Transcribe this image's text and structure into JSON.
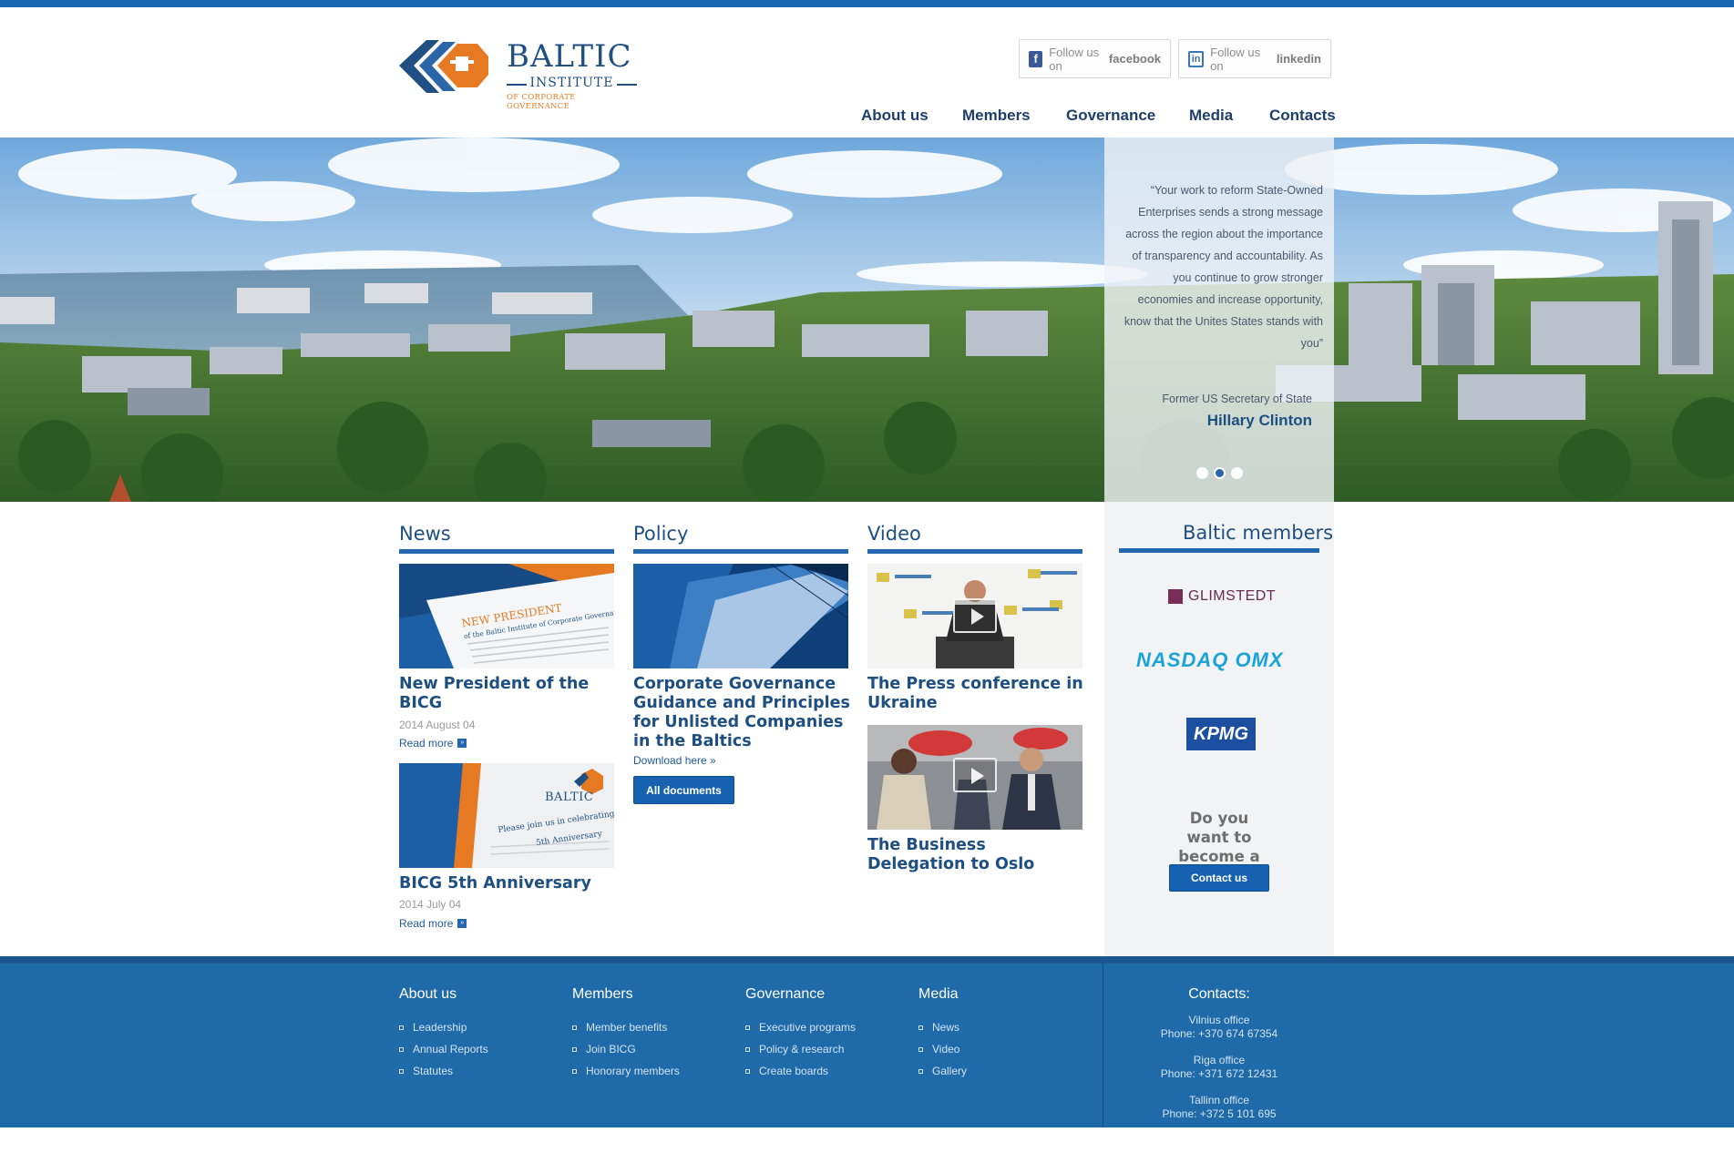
{
  "brand": {
    "title": "BALTIC",
    "subtitle": "INSTITUTE",
    "tagline": "OF CORPORATE GOVERNANCE"
  },
  "social": {
    "facebook": {
      "prefix": "Follow us on",
      "network": "facebook",
      "icon": "facebook-icon"
    },
    "linkedin": {
      "prefix": "Follow us on",
      "network": "linkedin",
      "icon": "linkedin-icon"
    }
  },
  "nav": [
    "About us",
    "Members",
    "Governance",
    "Media",
    "Contacts"
  ],
  "hero": {
    "quote": "“Your work to reform State-Owned Enterprises sends a strong message across the region about the importance of transparency and accountability. As you continue to grow stronger economies and increase opportunity, know that the Unites States stands with you”",
    "role": "Former US Secretary of State",
    "name": "Hillary Clinton",
    "slides": 3,
    "active_slide": 2
  },
  "news": {
    "title": "News",
    "items": [
      {
        "title": "New President of the BICG",
        "date": "2014 August 04",
        "more": "Read more",
        "thumb_text": "NEW PRESIDENT",
        "thumb_sub": "of the Baltic Institute of Corporate Governance Appointed"
      },
      {
        "title": "BICG 5th Anniversary",
        "date": "2014 July 04",
        "more": "Read more",
        "thumb_text": "Please join us in celebrating",
        "thumb_sub": "5th Anniversary"
      }
    ]
  },
  "policy": {
    "title": "Policy",
    "item_title": "Corporate Governance Guidance and Principles for Unlisted Companies in the Baltics",
    "download": "Download here »",
    "button": "All documents"
  },
  "video": {
    "title": "Video",
    "items": [
      {
        "title": "The Press conference in Ukraine"
      },
      {
        "title": "The Business Delegation to Oslo"
      }
    ]
  },
  "members": {
    "title": "Baltic members",
    "logos": [
      "GLIMSTEDT",
      "NASDAQ OMX",
      "KPMG"
    ],
    "cta": "Do you want to become a member?",
    "button": "Contact us"
  },
  "footer": {
    "columns": [
      {
        "title": "About us",
        "links": [
          "Leadership",
          "Annual Reports",
          "Statutes"
        ]
      },
      {
        "title": "Members",
        "links": [
          "Member benefits",
          "Join BICG",
          "Honorary members"
        ]
      },
      {
        "title": "Governance",
        "links": [
          "Executive programs",
          "Policy & research",
          "Create boards"
        ]
      },
      {
        "title": "Media",
        "links": [
          "News",
          "Video",
          "Gallery"
        ]
      }
    ],
    "contacts_title": "Contacts:",
    "offices": [
      {
        "name": "Vilnius office",
        "phone": "Phone: +370 674 67354"
      },
      {
        "name": "Riga office",
        "phone": "Phone: +371 672 12431"
      },
      {
        "name": "Tallinn office",
        "phone": "Phone: +372 5 101 695"
      }
    ]
  },
  "colors": {
    "brand_blue": "#1e4f82",
    "accent_blue": "#2467b1",
    "orange": "#e67a22",
    "footer_bg": "#1f6aa8"
  }
}
